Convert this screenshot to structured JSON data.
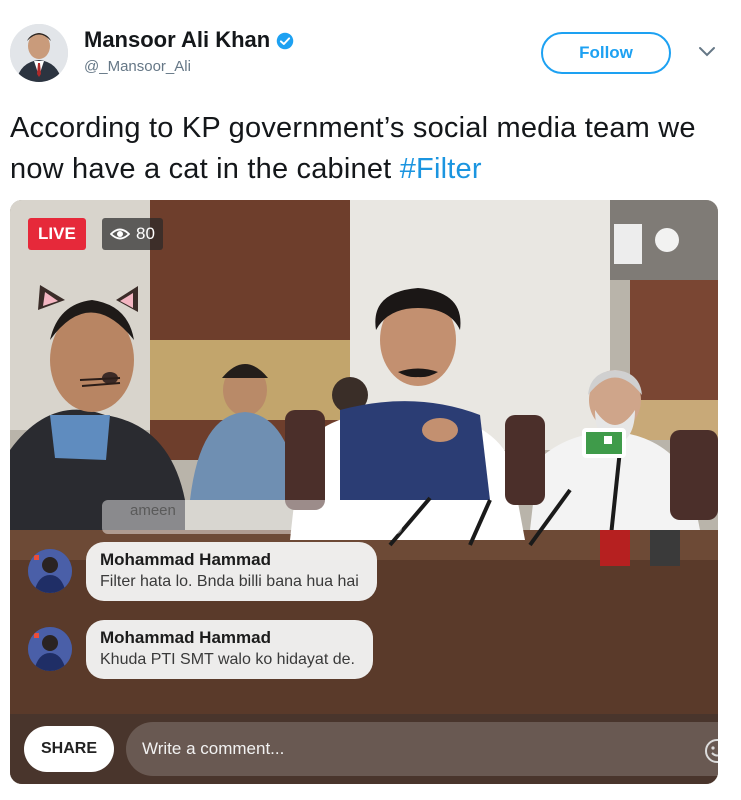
{
  "tweet": {
    "author_name": "Mansoor Ali Khan",
    "handle": "@_Mansoor_Ali",
    "follow_label": "Follow",
    "text_before": "According to KP government’s social media team we now have a cat in the cabinet ",
    "hashtag": "#Filter"
  },
  "video": {
    "live_label": "LIVE",
    "view_count": "80",
    "faded_comment": "ameen",
    "comments": [
      {
        "name": "Mohammad Hammad",
        "text": "Filter hata lo. Bnda billi bana hua hai"
      },
      {
        "name": "Mohammad Hammad",
        "text": "Khuda PTI SMT walo ko hidayat de."
      }
    ],
    "share_label": "SHARE",
    "comment_placeholder": "Write a comment..."
  },
  "colors": {
    "accent": "#1da1f2",
    "hashtag": "#1b95e0",
    "live": "#e6293a",
    "verified": "#1da1f2"
  },
  "icons": [
    "verified-badge-icon",
    "chevron-down-icon",
    "eye-icon",
    "emoji-icon"
  ]
}
